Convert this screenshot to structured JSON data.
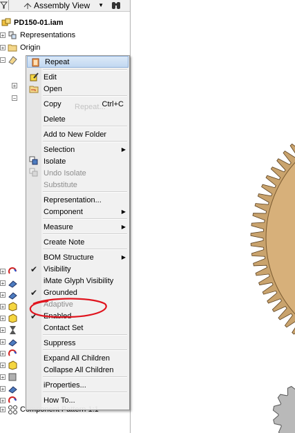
{
  "toolbar": {
    "view_label": "Assembly View"
  },
  "tree": {
    "root": "PD150-01.iam",
    "representations": "Representations",
    "origin": "Origin",
    "bottom_item": "Component Pattern 1:1"
  },
  "menu": {
    "items": [
      {
        "label": "Repeat"
      },
      {
        "label": "Edit"
      },
      {
        "label": "Open"
      },
      {
        "label": "Copy",
        "shortcut": "Ctrl+C"
      },
      {
        "label": "Delete"
      },
      {
        "label": "Add to New Folder"
      },
      {
        "label": "Selection"
      },
      {
        "label": "Isolate"
      },
      {
        "label": "Undo Isolate"
      },
      {
        "label": "Substitute"
      },
      {
        "label": "Representation..."
      },
      {
        "label": "Component"
      },
      {
        "label": "Measure"
      },
      {
        "label": "Create Note"
      },
      {
        "label": "BOM Structure"
      },
      {
        "label": "Visibility"
      },
      {
        "label": "iMate Glyph Visibility"
      },
      {
        "label": "Grounded"
      },
      {
        "label": "Adaptive"
      },
      {
        "label": "Enabled"
      },
      {
        "label": "Contact Set"
      },
      {
        "label": "Suppress"
      },
      {
        "label": "Expand All Children"
      },
      {
        "label": "Collapse All Children"
      },
      {
        "label": "iProperties..."
      },
      {
        "label": "How To..."
      }
    ]
  },
  "colors": {
    "highlight": "#c2d8f1",
    "gear": "#c9a36d",
    "annotation": "#e0141e"
  }
}
